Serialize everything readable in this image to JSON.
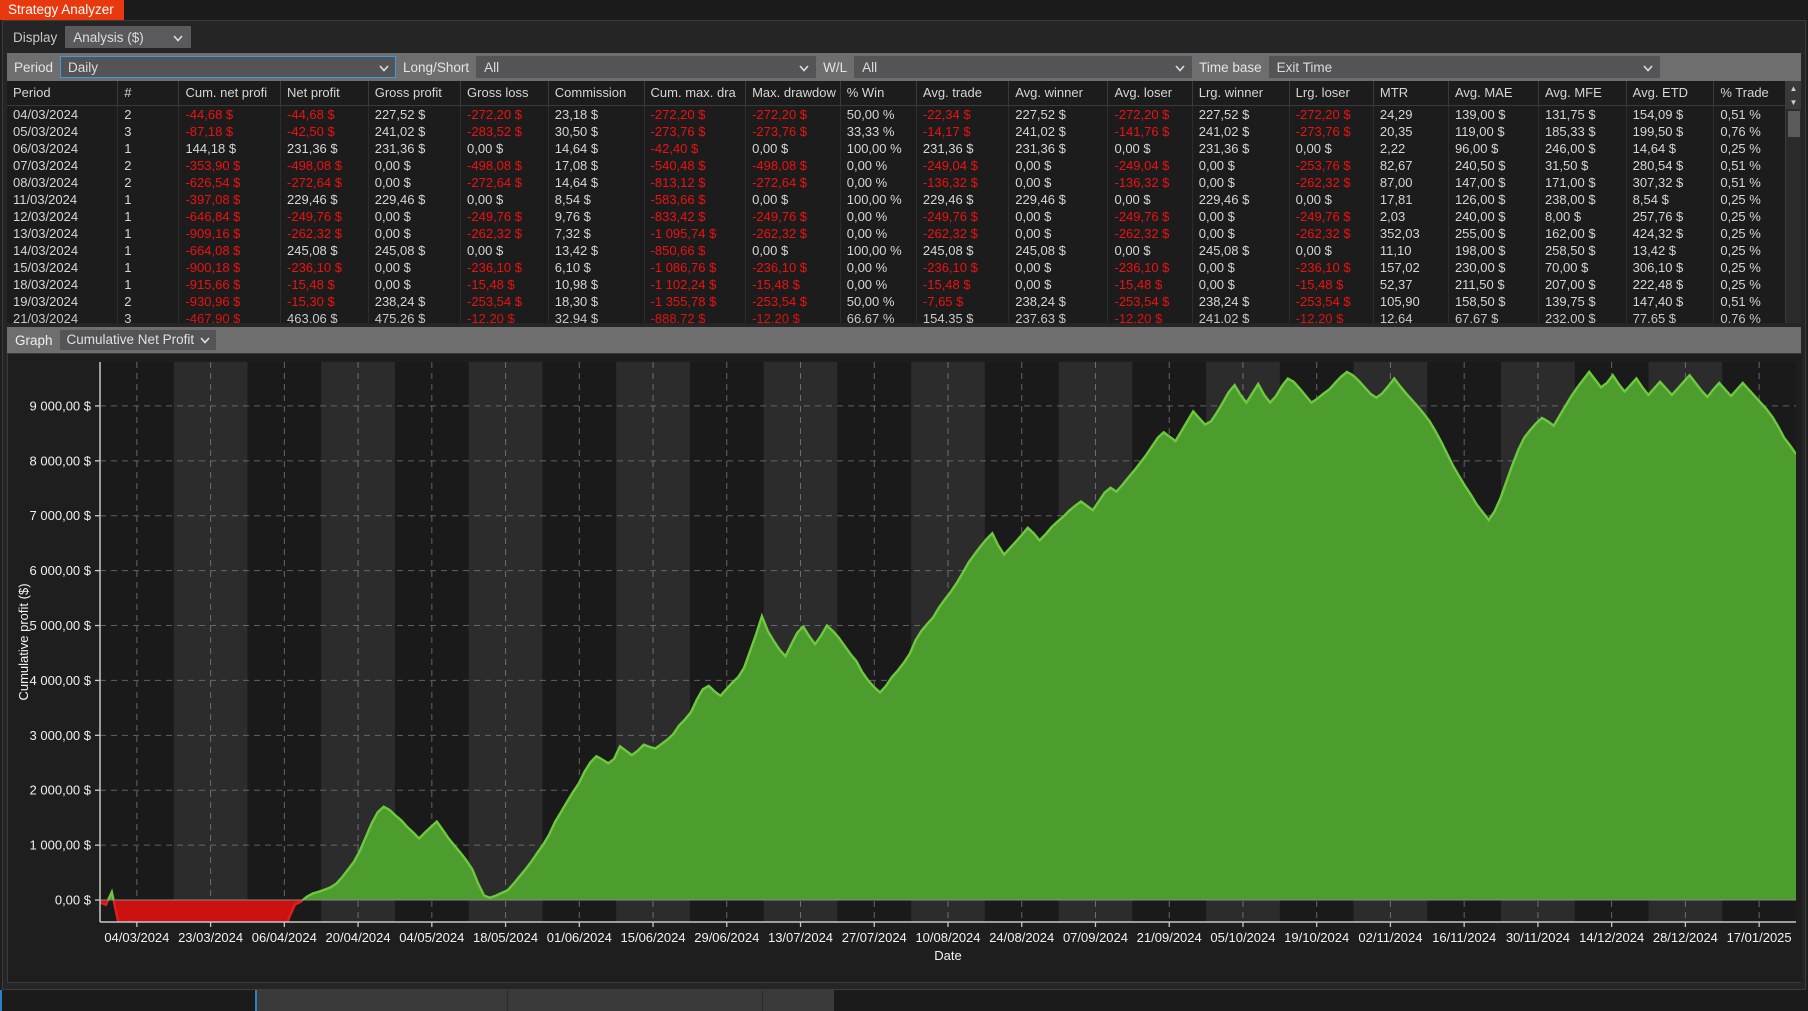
{
  "window": {
    "title": "Strategy Analyzer",
    "accent_color": "#e8380d"
  },
  "toolbar": {
    "display_label": "Display",
    "display_value": "Analysis ($)"
  },
  "filters": {
    "period_label": "Period",
    "period_value": "Daily",
    "longshort_label": "Long/Short",
    "longshort_value": "All",
    "wl_label": "W/L",
    "wl_value": "All",
    "timebase_label": "Time base",
    "timebase_value": "Exit Time"
  },
  "table": {
    "columns": [
      "Period",
      "#",
      "Cum. net profi",
      "Net profit",
      "Gross profit",
      "Gross loss",
      "Commission",
      "Cum. max. dra",
      "Max. drawdow",
      "% Win",
      "Avg. trade",
      "Avg. winner",
      "Avg. loser",
      "Lrg. winner",
      "Lrg. loser",
      "MTR",
      "Avg. MAE",
      "Avg. MFE",
      "Avg. ETD",
      "% Trade"
    ],
    "rows": [
      [
        "04/03/2024",
        "2",
        "-44,68 $",
        "-44,68 $",
        "227,52 $",
        "-272,20 $",
        "23,18 $",
        "-272,20 $",
        "-272,20 $",
        "50,00 %",
        "-22,34 $",
        "227,52 $",
        "-272,20 $",
        "227,52 $",
        "-272,20 $",
        "24,29",
        "139,00 $",
        "131,75 $",
        "154,09 $",
        "0,51 %"
      ],
      [
        "05/03/2024",
        "3",
        "-87,18 $",
        "-42,50 $",
        "241,02 $",
        "-283,52 $",
        "30,50 $",
        "-273,76 $",
        "-273,76 $",
        "33,33 %",
        "-14,17 $",
        "241,02 $",
        "-141,76 $",
        "241,02 $",
        "-273,76 $",
        "20,35",
        "119,00 $",
        "185,33 $",
        "199,50 $",
        "0,76 %"
      ],
      [
        "06/03/2024",
        "1",
        "144,18 $",
        "231,36 $",
        "231,36 $",
        "0,00 $",
        "14,64 $",
        "-42,40 $",
        "0,00 $",
        "100,00 %",
        "231,36 $",
        "231,36 $",
        "0,00 $",
        "231,36 $",
        "0,00 $",
        "2,22",
        "96,00 $",
        "246,00 $",
        "14,64 $",
        "0,25 %"
      ],
      [
        "07/03/2024",
        "2",
        "-353,90 $",
        "-498,08 $",
        "0,00 $",
        "-498,08 $",
        "17,08 $",
        "-540,48 $",
        "-498,08 $",
        "0,00 %",
        "-249,04 $",
        "0,00 $",
        "-249,04 $",
        "0,00 $",
        "-253,76 $",
        "82,67",
        "240,50 $",
        "31,50 $",
        "280,54 $",
        "0,51 %"
      ],
      [
        "08/03/2024",
        "2",
        "-626,54 $",
        "-272,64 $",
        "0,00 $",
        "-272,64 $",
        "14,64 $",
        "-813,12 $",
        "-272,64 $",
        "0,00 %",
        "-136,32 $",
        "0,00 $",
        "-136,32 $",
        "0,00 $",
        "-262,32 $",
        "87,00",
        "147,00 $",
        "171,00 $",
        "307,32 $",
        "0,51 %"
      ],
      [
        "11/03/2024",
        "1",
        "-397,08 $",
        "229,46 $",
        "229,46 $",
        "0,00 $",
        "8,54 $",
        "-583,66 $",
        "0,00 $",
        "100,00 %",
        "229,46 $",
        "229,46 $",
        "0,00 $",
        "229,46 $",
        "0,00 $",
        "17,81",
        "126,00 $",
        "238,00 $",
        "8,54 $",
        "0,25 %"
      ],
      [
        "12/03/2024",
        "1",
        "-646,84 $",
        "-249,76 $",
        "0,00 $",
        "-249,76 $",
        "9,76 $",
        "-833,42 $",
        "-249,76 $",
        "0,00 %",
        "-249,76 $",
        "0,00 $",
        "-249,76 $",
        "0,00 $",
        "-249,76 $",
        "2,03",
        "240,00 $",
        "8,00 $",
        "257,76 $",
        "0,25 %"
      ],
      [
        "13/03/2024",
        "1",
        "-909,16 $",
        "-262,32 $",
        "0,00 $",
        "-262,32 $",
        "7,32 $",
        "-1 095,74 $",
        "-262,32 $",
        "0,00 %",
        "-262,32 $",
        "0,00 $",
        "-262,32 $",
        "0,00 $",
        "-262,32 $",
        "352,03",
        "255,00 $",
        "162,00 $",
        "424,32 $",
        "0,25 %"
      ],
      [
        "14/03/2024",
        "1",
        "-664,08 $",
        "245,08 $",
        "245,08 $",
        "0,00 $",
        "13,42 $",
        "-850,66 $",
        "0,00 $",
        "100,00 %",
        "245,08 $",
        "245,08 $",
        "0,00 $",
        "245,08 $",
        "0,00 $",
        "11,10",
        "198,00 $",
        "258,50 $",
        "13,42 $",
        "0,25 %"
      ],
      [
        "15/03/2024",
        "1",
        "-900,18 $",
        "-236,10 $",
        "0,00 $",
        "-236,10 $",
        "6,10 $",
        "-1 086,76 $",
        "-236,10 $",
        "0,00 %",
        "-236,10 $",
        "0,00 $",
        "-236,10 $",
        "0,00 $",
        "-236,10 $",
        "157,02",
        "230,00 $",
        "70,00 $",
        "306,10 $",
        "0,25 %"
      ],
      [
        "18/03/2024",
        "1",
        "-915,66 $",
        "-15,48 $",
        "0,00 $",
        "-15,48 $",
        "10,98 $",
        "-1 102,24 $",
        "-15,48 $",
        "0,00 %",
        "-15,48 $",
        "0,00 $",
        "-15,48 $",
        "0,00 $",
        "-15,48 $",
        "52,37",
        "211,50 $",
        "207,00 $",
        "222,48 $",
        "0,25 %"
      ],
      [
        "19/03/2024",
        "2",
        "-930,96 $",
        "-15,30 $",
        "238,24 $",
        "-253,54 $",
        "18,30 $",
        "-1 355,78 $",
        "-253,54 $",
        "50,00 %",
        "-7,65 $",
        "238,24 $",
        "-253,54 $",
        "238,24 $",
        "-253,54 $",
        "105,90",
        "158,50 $",
        "139,75 $",
        "147,40 $",
        "0,51 %"
      ],
      [
        "21/03/2024",
        "3",
        "-467,90 $",
        "463,06 $",
        "475,26 $",
        "-12,20 $",
        "32,94 $",
        "-888,72 $",
        "-12,20 $",
        "66,67 %",
        "154,35 $",
        "237,63 $",
        "-12,20 $",
        "241,02 $",
        "-12,20 $",
        "12,64",
        "67,67 $",
        "232,00 $",
        "77,65 $",
        "0,76 %"
      ]
    ],
    "negative_cells": {
      "0": [
        2,
        3,
        5,
        7,
        8,
        10,
        12,
        14
      ],
      "1": [
        2,
        3,
        5,
        7,
        8,
        10,
        12,
        14
      ],
      "2": [
        7
      ],
      "3": [
        2,
        3,
        5,
        7,
        8,
        10,
        12,
        14
      ],
      "4": [
        2,
        3,
        5,
        7,
        8,
        10,
        12,
        14
      ],
      "5": [
        2,
        7
      ],
      "6": [
        2,
        3,
        5,
        7,
        8,
        10,
        12,
        14
      ],
      "7": [
        2,
        3,
        5,
        7,
        8,
        10,
        12,
        14
      ],
      "8": [
        2,
        7
      ],
      "9": [
        2,
        3,
        5,
        7,
        8,
        10,
        12,
        14
      ],
      "10": [
        2,
        3,
        5,
        7,
        8,
        10,
        12,
        14
      ],
      "11": [
        2,
        3,
        5,
        7,
        8,
        10,
        12,
        14
      ],
      "12": [
        2,
        5,
        7,
        8,
        12,
        14
      ]
    }
  },
  "graph": {
    "label": "Graph",
    "selected": "Cumulative Net Profit"
  },
  "chart_data": {
    "type": "area",
    "title": "",
    "xlabel": "Date",
    "ylabel": "Cumulative profit ($)",
    "ylim": [
      -400,
      9800
    ],
    "yticks": [
      0,
      1000,
      2000,
      3000,
      4000,
      5000,
      6000,
      7000,
      8000,
      9000
    ],
    "ytick_labels": [
      "0,00 $",
      "1 000,00 $",
      "2 000,00 $",
      "3 000,00 $",
      "4 000,00 $",
      "5 000,00 $",
      "6 000,00 $",
      "7 000,00 $",
      "8 000,00 $",
      "9 000,00 $"
    ],
    "xtick_labels": [
      "04/03/2024",
      "23/03/2024",
      "06/04/2024",
      "20/04/2024",
      "04/05/2024",
      "18/05/2024",
      "01/06/2024",
      "15/06/2024",
      "29/06/2024",
      "13/07/2024",
      "27/07/2024",
      "10/08/2024",
      "24/08/2024",
      "07/09/2024",
      "21/09/2024",
      "05/10/2024",
      "19/10/2024",
      "02/11/2024",
      "16/11/2024",
      "30/11/2024",
      "14/12/2024",
      "28/12/2024",
      "17/01/2025"
    ],
    "grid": true,
    "positive_color": "#4c9c2e",
    "positive_line_color": "#6ec93f",
    "negative_color": "#cc1111",
    "negative_line_color": "#e02020",
    "series": [
      {
        "name": "Cumulative Net Profit",
        "values": [
          -45,
          -87,
          144,
          -354,
          -627,
          -397,
          -647,
          -909,
          -664,
          -900,
          -916,
          -931,
          -468,
          -540,
          -700,
          -1060,
          -1130,
          -1000,
          -1160,
          -1180,
          -1180,
          -1150,
          -1120,
          -1100,
          -1090,
          -1080,
          -900,
          -720,
          -640,
          -760,
          -880,
          -620,
          -320,
          -80,
          -30,
          60,
          120,
          150,
          190,
          230,
          300,
          420,
          560,
          700,
          900,
          1150,
          1400,
          1600,
          1700,
          1640,
          1540,
          1450,
          1330,
          1230,
          1120,
          1230,
          1330,
          1430,
          1280,
          1120,
          990,
          860,
          720,
          560,
          300,
          80,
          40,
          80,
          130,
          180,
          300,
          430,
          560,
          700,
          860,
          1010,
          1190,
          1420,
          1600,
          1780,
          1960,
          2120,
          2340,
          2510,
          2620,
          2560,
          2490,
          2570,
          2800,
          2720,
          2640,
          2720,
          2830,
          2790,
          2760,
          2840,
          2920,
          3020,
          3180,
          3290,
          3420,
          3650,
          3840,
          3900,
          3800,
          3720,
          3840,
          3960,
          4060,
          4230,
          4530,
          4830,
          5170,
          4900,
          4720,
          4560,
          4440,
          4660,
          4870,
          4980,
          4810,
          4660,
          4810,
          5000,
          4900,
          4780,
          4630,
          4480,
          4350,
          4150,
          4000,
          3880,
          3780,
          3900,
          4060,
          4180,
          4320,
          4480,
          4730,
          4900,
          5030,
          5150,
          5330,
          5480,
          5620,
          5780,
          5960,
          6150,
          6300,
          6440,
          6570,
          6680,
          6460,
          6290,
          6410,
          6530,
          6650,
          6780,
          6680,
          6550,
          6660,
          6790,
          6890,
          6980,
          7090,
          7180,
          7260,
          7180,
          7100,
          7260,
          7420,
          7510,
          7440,
          7560,
          7690,
          7820,
          7960,
          8100,
          8260,
          8420,
          8520,
          8440,
          8360,
          8540,
          8720,
          8900,
          8780,
          8660,
          8720,
          8880,
          9060,
          9250,
          9380,
          9200,
          9060,
          9230,
          9400,
          9200,
          9060,
          9180,
          9360,
          9500,
          9440,
          9320,
          9190,
          9060,
          9130,
          9220,
          9300,
          9420,
          9530,
          9620,
          9560,
          9460,
          9340,
          9220,
          9150,
          9230,
          9360,
          9500,
          9360,
          9230,
          9110,
          8990,
          8860,
          8720,
          8540,
          8340,
          8120,
          7900,
          7720,
          7540,
          7380,
          7200,
          7060,
          6920,
          7080,
          7320,
          7620,
          7920,
          8200,
          8420,
          8560,
          8680,
          8780,
          8720,
          8640,
          8820,
          9000,
          9180,
          9340,
          9480,
          9620,
          9480,
          9340,
          9420,
          9560,
          9400,
          9260,
          9380,
          9500,
          9340,
          9200,
          9320,
          9440,
          9320,
          9200,
          9320,
          9440,
          9560,
          9420,
          9280,
          9160,
          9300,
          9420,
          9300,
          9180,
          9300,
          9420,
          9300,
          9180,
          9060,
          8940,
          8800,
          8620,
          8420,
          8280,
          8120
        ]
      }
    ]
  },
  "scrollbar": {
    "up_icon": "▲",
    "down_icon": "▼"
  },
  "icons": {
    "chevron_down": "⌄"
  }
}
